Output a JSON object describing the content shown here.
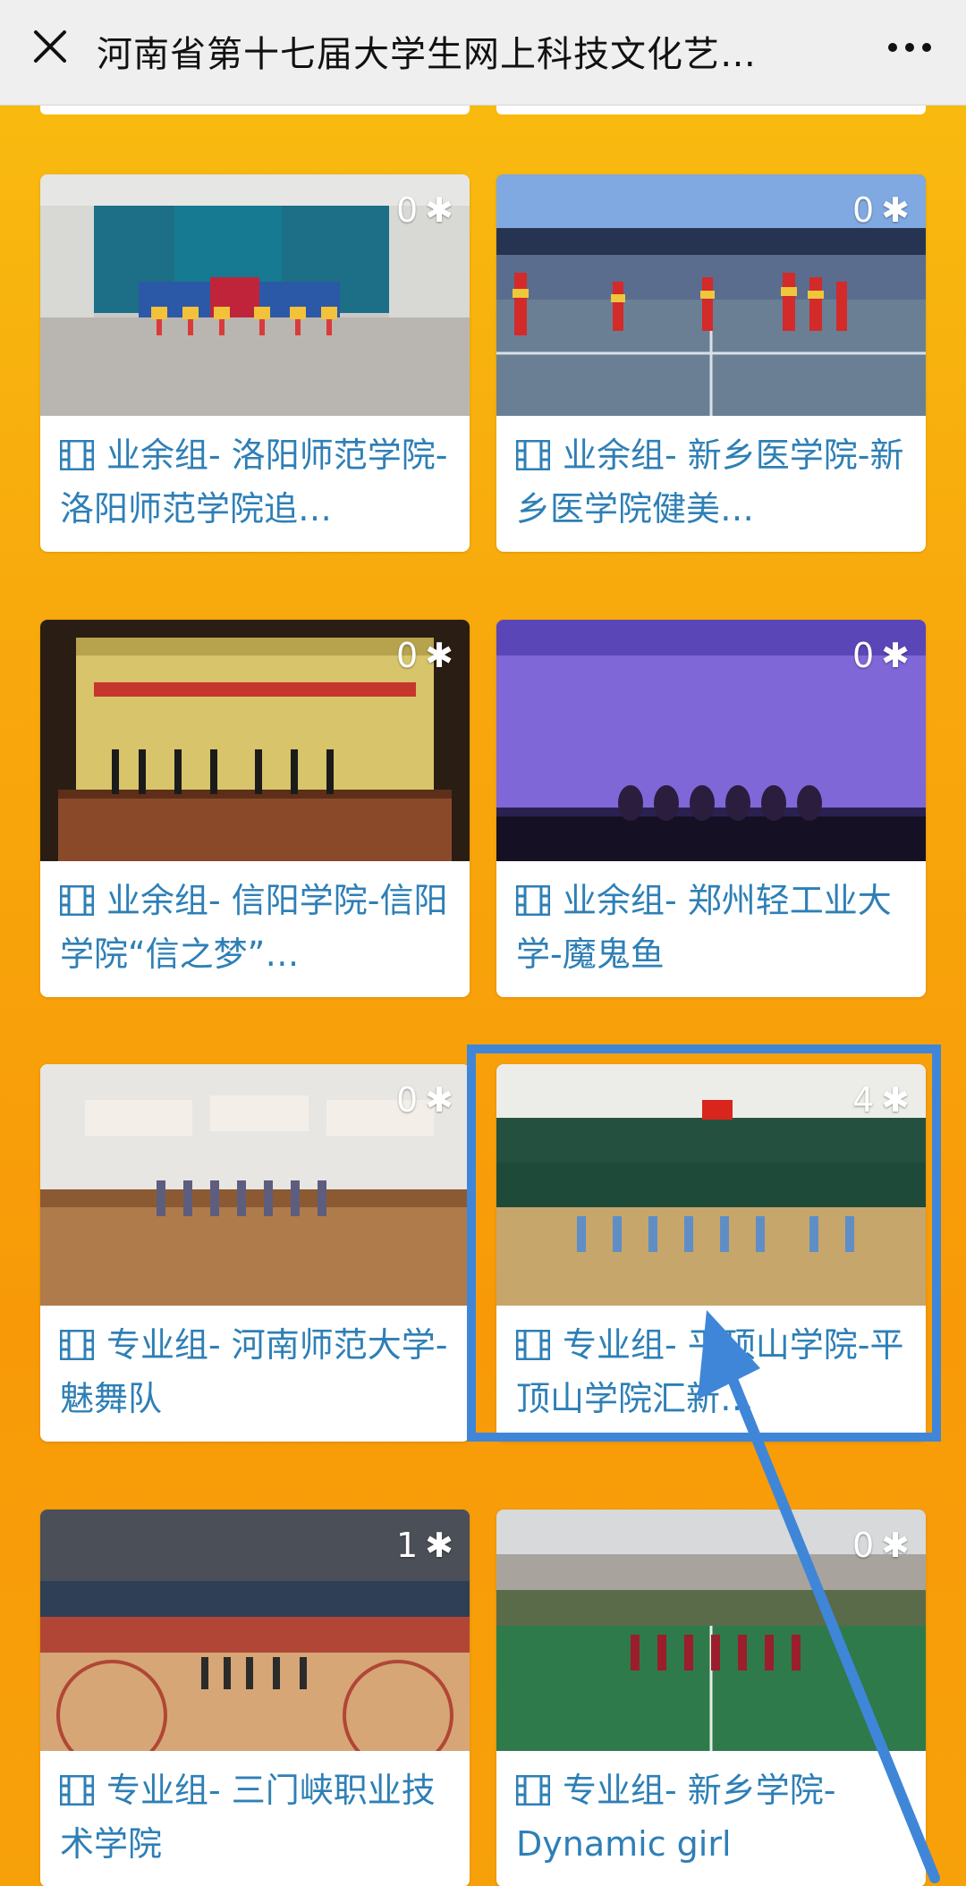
{
  "topbar": {
    "title": "河南省第十七届大学生网上科技文化艺…",
    "close_icon": "close-icon",
    "more_icon": "more-icon"
  },
  "cards": [
    {
      "likes": "0",
      "caption": "业余组- 洛阳师范学院-洛阳师范学院追…",
      "scene": "gym-blue-curtain"
    },
    {
      "likes": "0",
      "caption": "业余组- 新乡医学院-新乡医学院健美…",
      "scene": "gym-red-dancers"
    },
    {
      "likes": "0",
      "caption": "业余组- 信阳学院-信阳学院“信之梦”…",
      "scene": "stage-yellow-curtain"
    },
    {
      "likes": "0",
      "caption": "业余组- 郑州轻工业大学-魔鬼鱼",
      "scene": "stage-purple"
    },
    {
      "likes": "0",
      "caption": "专业组- 河南师范大学-魅舞队",
      "scene": "gym-wood-floor"
    },
    {
      "likes": "4",
      "caption": "专业组- 平顶山学院-平顶山学院汇新…",
      "scene": "arena-flag"
    },
    {
      "likes": "1",
      "caption": "专业组- 三门峡职业技术学院",
      "scene": "basketball-arena"
    },
    {
      "likes": "0",
      "caption": "专业组- 新乡学院-Dynamic girl",
      "scene": "outdoor-field"
    }
  ],
  "colors": {
    "background": "#f8a80c",
    "caption_text": "#2e7fb6",
    "highlight": "#3f86d8"
  },
  "icons": {
    "film": "film-icon",
    "like": "asterisk-like-icon"
  }
}
